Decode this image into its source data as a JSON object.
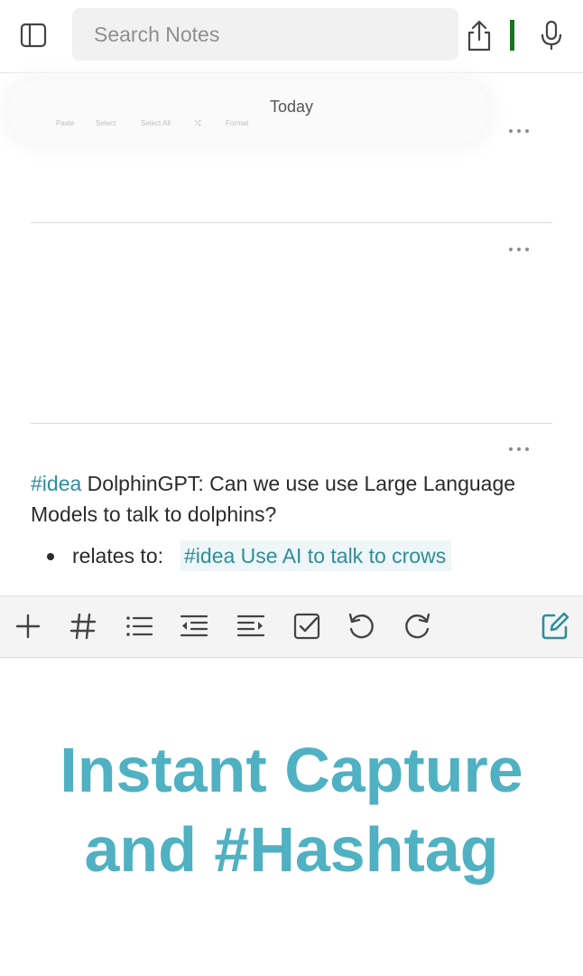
{
  "search": {
    "placeholder": "Search Notes"
  },
  "date_section": {
    "label": "Today"
  },
  "ghost_toolbar": {
    "items": [
      "Paste",
      "Select",
      "Select All",
      "⤭",
      "Format"
    ]
  },
  "notes": [
    {
      "id": "note-1"
    },
    {
      "id": "note-2"
    },
    {
      "id": "note-3",
      "tag": "#idea",
      "body": " DolphinGPT: Can we use use Large Language Models to talk to dolphins?",
      "bullet": {
        "label": "relates to:",
        "link_text": "#idea Use AI to talk to crows"
      }
    }
  ],
  "toolbar_icons": [
    "plus-icon",
    "hashtag-icon",
    "bulleted-list-icon",
    "outdent-icon",
    "indent-icon",
    "checkbox-icon",
    "undo-icon",
    "redo-icon",
    "compose-icon"
  ],
  "promo": {
    "line1": "Instant Capture",
    "line2": "and #Hashtag"
  },
  "colors": {
    "accent": "#2f8d9b",
    "promo": "#4fb1c1",
    "cursor": "#16751f"
  }
}
